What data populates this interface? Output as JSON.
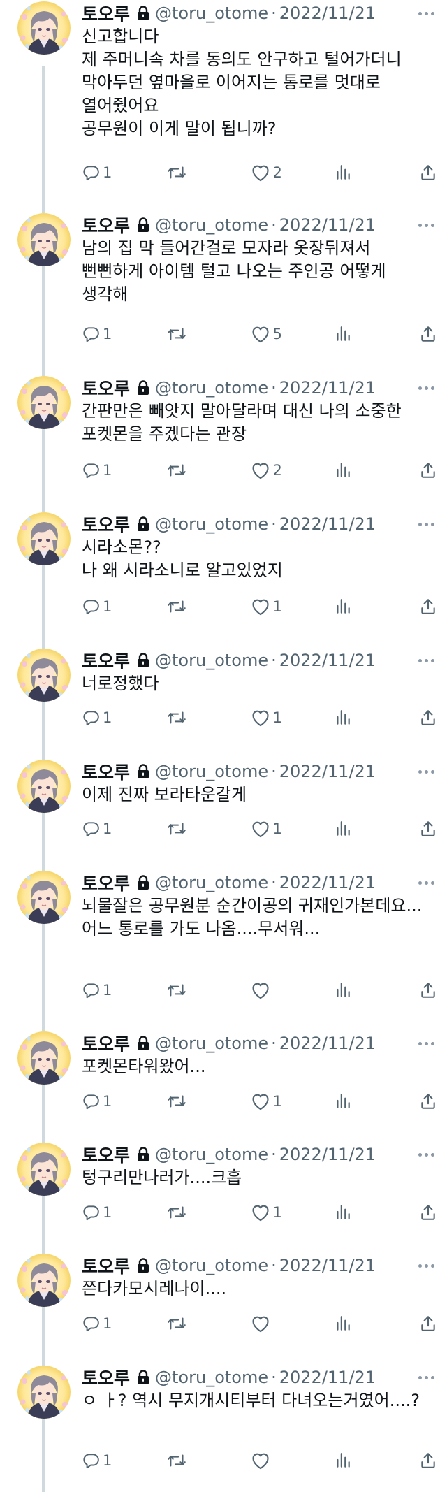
{
  "colors": {
    "name": "#0f1419",
    "muted": "#536471",
    "thread_line": "#cfd9de"
  },
  "icons": [
    "avatar-portrait",
    "lock-icon",
    "more-icon",
    "reply-icon",
    "retweet-icon",
    "like-icon",
    "analytics-icon",
    "share-icon"
  ],
  "tweets": [
    {
      "name": "토오루",
      "handle": "@toru_otome",
      "separator": "·",
      "date": "2022/11/21",
      "text": "신고합니다\n제 주머니속 차를 동의도 안구하고 털어가더니 막아두던 옆마을로 이어지는 통로를 멋대로 열어줬어요\n공무원이 이게 말이 됩니까?",
      "replies": "1",
      "retweets": "",
      "likes": "2"
    },
    {
      "name": "토오루",
      "handle": "@toru_otome",
      "separator": "·",
      "date": "2022/11/21",
      "text": "남의 집 막 들어간걸로 모자라 옷장뒤져서 뻔뻔하게 아이템 털고 나오는 주인공 어떻게 생각해",
      "replies": "1",
      "retweets": "",
      "likes": "5"
    },
    {
      "name": "토오루",
      "handle": "@toru_otome",
      "separator": "·",
      "date": "2022/11/21",
      "text": "간판만은 빼앗지 말아달라며 대신 나의 소중한 포켓몬을 주겠다는 관장",
      "replies": "1",
      "retweets": "",
      "likes": "2"
    },
    {
      "name": "토오루",
      "handle": "@toru_otome",
      "separator": "·",
      "date": "2022/11/21",
      "text": "시라소몬??\n나 왜 시라소니로 알고있었지",
      "replies": "1",
      "retweets": "",
      "likes": "1"
    },
    {
      "name": "토오루",
      "handle": "@toru_otome",
      "separator": "·",
      "date": "2022/11/21",
      "text": "너로정했다",
      "replies": "1",
      "retweets": "",
      "likes": "1"
    },
    {
      "name": "토오루",
      "handle": "@toru_otome",
      "separator": "·",
      "date": "2022/11/21",
      "text": "이제 진짜 보라타운갈게",
      "replies": "1",
      "retweets": "",
      "likes": "1"
    },
    {
      "name": "토오루",
      "handle": "@toru_otome",
      "separator": "·",
      "date": "2022/11/21",
      "text": "뇌물잘은 공무원분 순간이공의 귀재인가본데요...\n어느 통로를 가도 나옴....무서워...",
      "replies": "1",
      "retweets": "",
      "likes": ""
    },
    {
      "name": "토오루",
      "handle": "@toru_otome",
      "separator": "·",
      "date": "2022/11/21",
      "text": "포켓몬타워왔어...",
      "replies": "1",
      "retweets": "",
      "likes": "1"
    },
    {
      "name": "토오루",
      "handle": "@toru_otome",
      "separator": "·",
      "date": "2022/11/21",
      "text": "텅구리만나러가....크흡",
      "replies": "1",
      "retweets": "",
      "likes": "1"
    },
    {
      "name": "토오루",
      "handle": "@toru_otome",
      "separator": "·",
      "date": "2022/11/21",
      "text": "쯘다카모시레나이....",
      "replies": "1",
      "retweets": "",
      "likes": ""
    },
    {
      "name": "토오루",
      "handle": "@toru_otome",
      "separator": "·",
      "date": "2022/11/21",
      "text": "ㅇ ㅏ? 역시 무지개시티부터 다녀오는거였어....?",
      "replies": "1",
      "retweets": "",
      "likes": ""
    }
  ]
}
